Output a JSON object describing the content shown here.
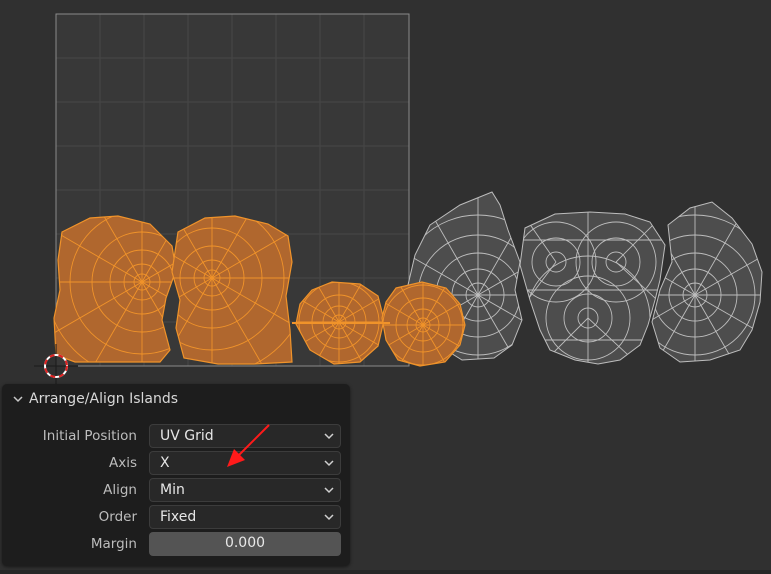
{
  "colors": {
    "background": "#303030",
    "uv_bounds_border": "#8a8a8a",
    "grid_line": "#474747",
    "selected_face": "#b0672e",
    "selected_edge": "#f0932a",
    "unselected_face": "#4d4d4d",
    "unselected_edge": "#bdbdbd",
    "annotation_arrow": "#ff1a1a",
    "panel_bg": "#1d1d1d"
  },
  "panel": {
    "title": "Arrange/Align Islands",
    "collapse_icon": "chevron-down-icon",
    "fields": {
      "initial_position": {
        "label": "Initial Position",
        "value": "UV Grid"
      },
      "axis": {
        "label": "Axis",
        "value": "X"
      },
      "align": {
        "label": "Align",
        "value": "Min"
      },
      "order": {
        "label": "Order",
        "value": "Fixed"
      },
      "margin": {
        "label": "Margin",
        "value": "0.000"
      }
    }
  }
}
